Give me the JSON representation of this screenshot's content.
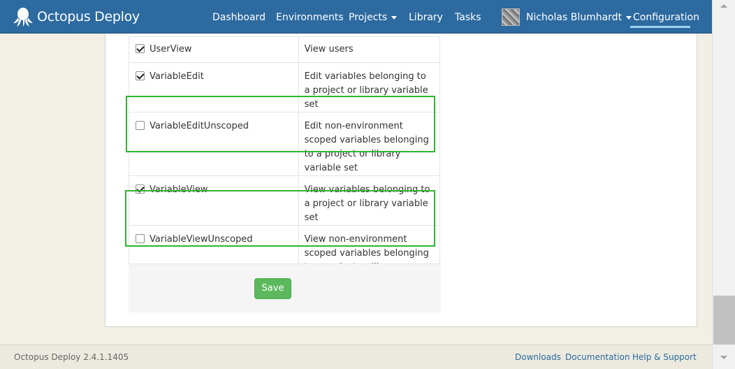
{
  "navbar": {
    "brand": "Octopus Deploy",
    "items": {
      "dashboard": "Dashboard",
      "environments": "Environments",
      "projects": "Projects",
      "library": "Library",
      "tasks": "Tasks",
      "user": "Nicholas Blumhardt",
      "configuration": "Configuration"
    }
  },
  "permissions": [
    {
      "name": "UserView",
      "checked": true,
      "description": "View users"
    },
    {
      "name": "VariableEdit",
      "checked": true,
      "description": "Edit variables belonging to a project or library variable set"
    },
    {
      "name": "VariableEditUnscoped",
      "checked": false,
      "description": "Edit non-environment scoped variables belonging to a project or library variable set"
    },
    {
      "name": "VariableView",
      "checked": true,
      "description": "View variables belonging to a project or library variable set"
    },
    {
      "name": "VariableViewUnscoped",
      "checked": false,
      "description": "View non-environment scoped variables belonging to a project or library variable set"
    }
  ],
  "actions": {
    "save_label": "Save"
  },
  "footer": {
    "version": "Octopus Deploy 2.4.1.1405",
    "links": {
      "downloads": "Downloads",
      "documentation": "Documentation",
      "help": "Help & Support"
    }
  },
  "colors": {
    "navbar": "#2c6aa0",
    "accent_underline": "#9fd2f5",
    "save_button": "#5cb85c",
    "highlight_box": "#2fb52f",
    "link": "#2c6aa0"
  },
  "icons": {
    "logo": "octopus-logo-icon",
    "checkbox": "checkbox-icon",
    "caret": "caret-down-icon"
  }
}
